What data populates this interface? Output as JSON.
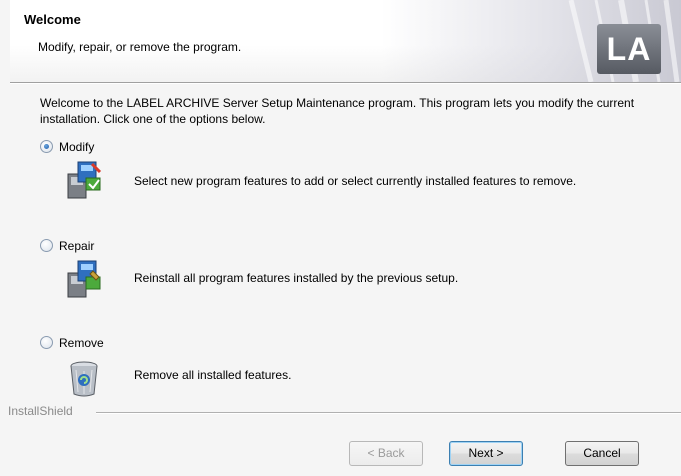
{
  "header": {
    "title": "Welcome",
    "subtitle": "Modify, repair, or remove the program.",
    "logo_text": "LA"
  },
  "intro": "Welcome to the LABEL ARCHIVE Server Setup Maintenance program. This program lets you modify the current installation. Click one of the options below.",
  "options": [
    {
      "label": "Modify",
      "selected": true,
      "icon": "modify-setup-icon",
      "description": "Select new program features to add or select currently installed features to remove."
    },
    {
      "label": "Repair",
      "selected": false,
      "icon": "repair-setup-icon",
      "description": "Reinstall all program features installed by the previous setup."
    },
    {
      "label": "Remove",
      "selected": false,
      "icon": "recycle-bin-icon",
      "description": "Remove all installed features."
    }
  ],
  "footer": {
    "brand": "InstallShield",
    "back_label": "< Back",
    "next_label": "Next >",
    "cancel_label": "Cancel"
  },
  "colors": {
    "accent": "#1f5aa8",
    "default_button_border": "#3c7fb1",
    "muted_text": "#8a8a8a"
  }
}
